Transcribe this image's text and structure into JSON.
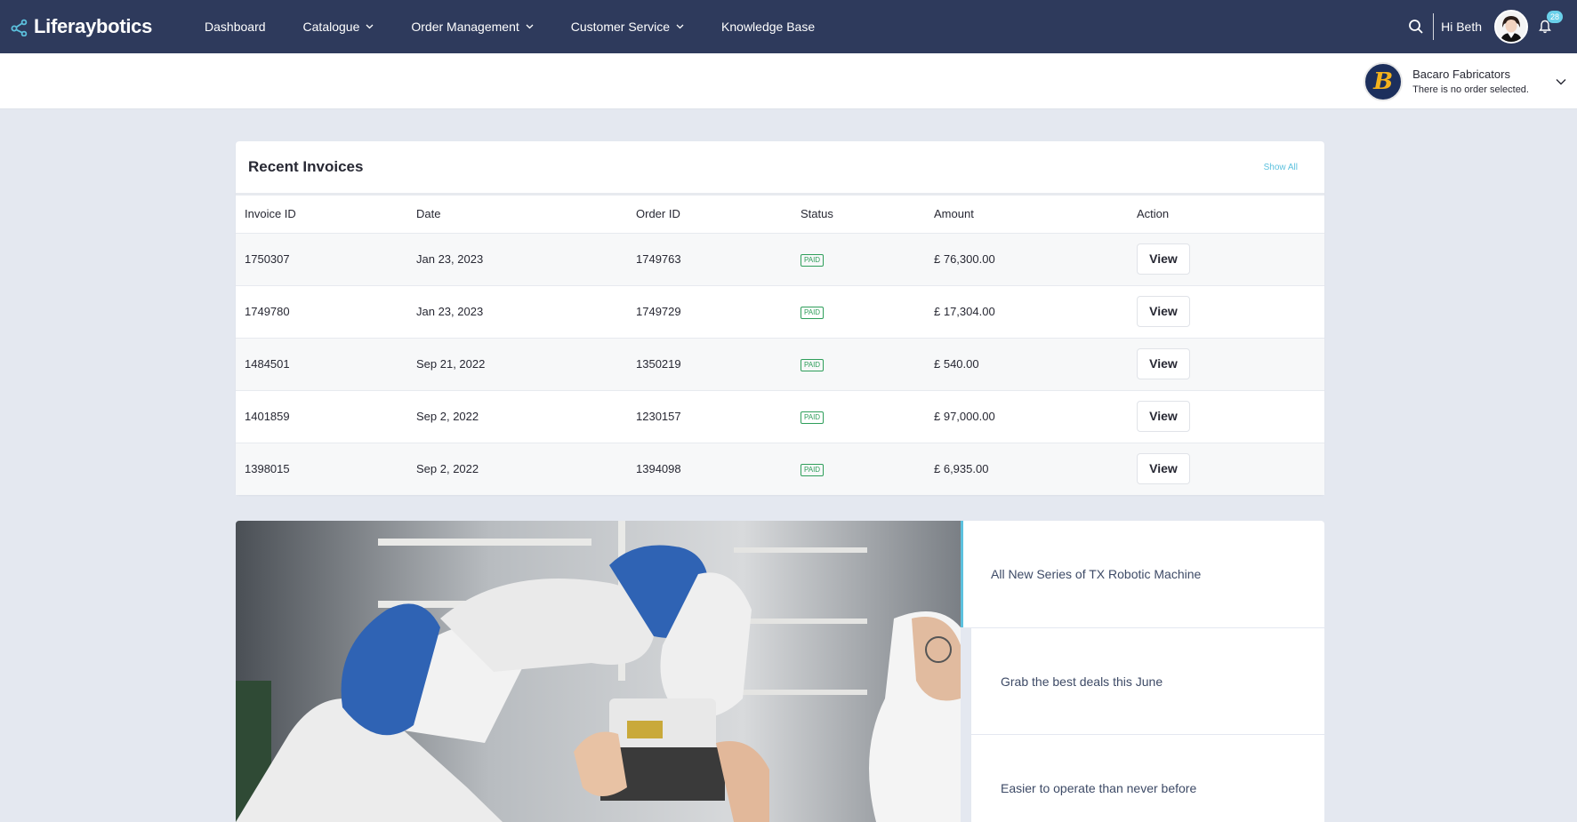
{
  "app": {
    "brand_name": "Liferaybotics",
    "brand_icon": "share-nodes-icon",
    "accent_color": "#5cc1de",
    "nav_color": "#2e3a5c"
  },
  "nav": {
    "items": [
      {
        "label": "Dashboard",
        "has_dropdown": false
      },
      {
        "label": "Catalogue",
        "has_dropdown": true
      },
      {
        "label": "Order Management",
        "has_dropdown": true
      },
      {
        "label": "Customer Service",
        "has_dropdown": true
      },
      {
        "label": "Knowledge Base",
        "has_dropdown": false
      }
    ]
  },
  "user": {
    "greeting": "Hi Beth",
    "notification_count": "28"
  },
  "account": {
    "logo_letter": "B",
    "name": "Bacaro Fabricators",
    "order_status": "There is no order selected."
  },
  "invoices": {
    "title": "Recent Invoices",
    "show_all_label": "Show All",
    "columns": [
      "Invoice ID",
      "Date",
      "Order ID",
      "Status",
      "Amount",
      "Action"
    ],
    "rows": [
      {
        "invoice_id": "1750307",
        "date": "Jan 23, 2023",
        "order_id": "1749763",
        "status": "PAID",
        "amount": "£ 76,300.00",
        "action": "View"
      },
      {
        "invoice_id": "1749780",
        "date": "Jan 23, 2023",
        "order_id": "1749729",
        "status": "PAID",
        "amount": "£ 17,304.00",
        "action": "View"
      },
      {
        "invoice_id": "1484501",
        "date": "Sep 21, 2022",
        "order_id": "1350219",
        "status": "PAID",
        "amount": "£ 540.00",
        "action": "View"
      },
      {
        "invoice_id": "1401859",
        "date": "Sep 2, 2022",
        "order_id": "1230157",
        "status": "PAID",
        "amount": "£ 97,000.00",
        "action": "View"
      },
      {
        "invoice_id": "1398015",
        "date": "Sep 2, 2022",
        "order_id": "1394098",
        "status": "PAID",
        "amount": "£ 6,935.00",
        "action": "View"
      }
    ]
  },
  "promo": {
    "items": [
      {
        "label": "All New Series of TX Robotic Machine",
        "active": true
      },
      {
        "label": "Grab the best deals this June",
        "active": false
      },
      {
        "label": "Easier to operate than never before",
        "active": false
      }
    ]
  }
}
